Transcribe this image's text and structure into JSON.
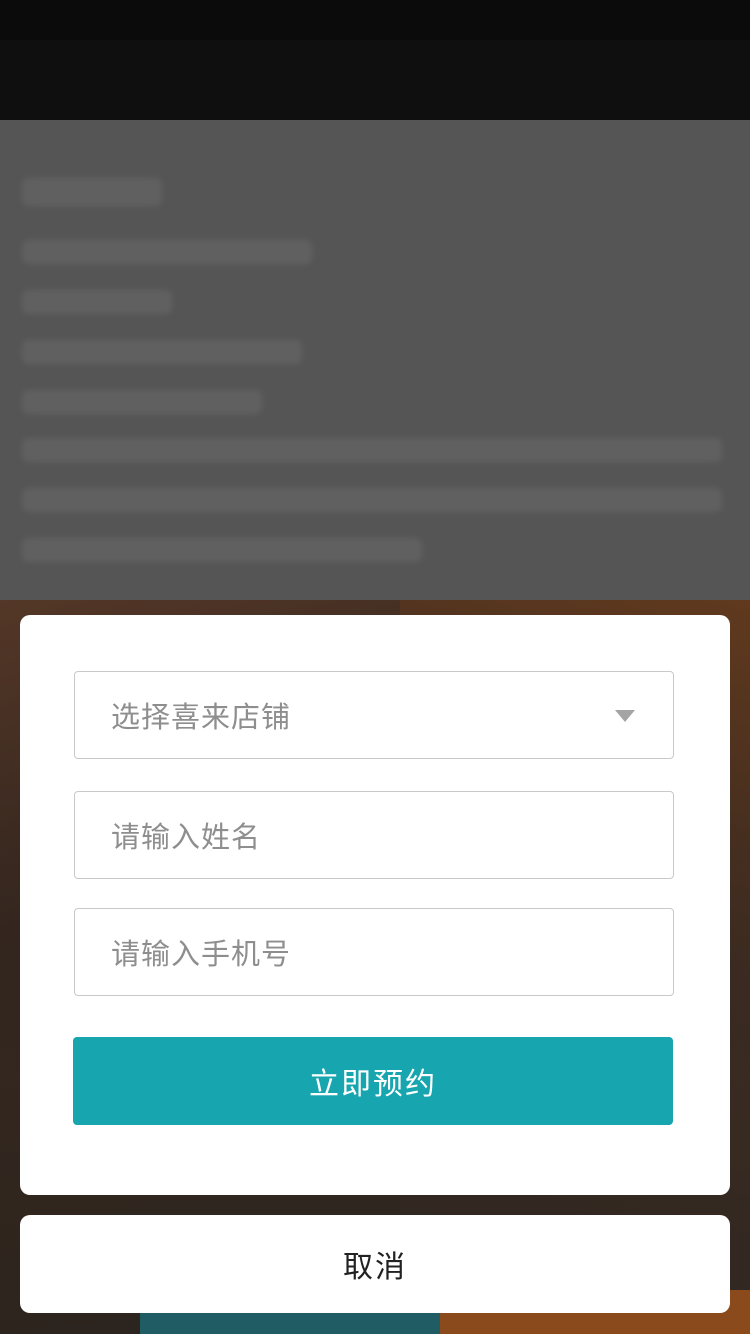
{
  "form": {
    "store_select": {
      "placeholder": "选择喜来店铺"
    },
    "name_input": {
      "placeholder": "请输入姓名"
    },
    "phone_input": {
      "placeholder": "请输入手机号"
    },
    "submit_label": "立即预约"
  },
  "actions": {
    "cancel_label": "取消"
  },
  "colors": {
    "accent": "#17a6af",
    "overlay": "#555555"
  },
  "icons": {
    "store_select_caret": "chevron-down-icon"
  }
}
